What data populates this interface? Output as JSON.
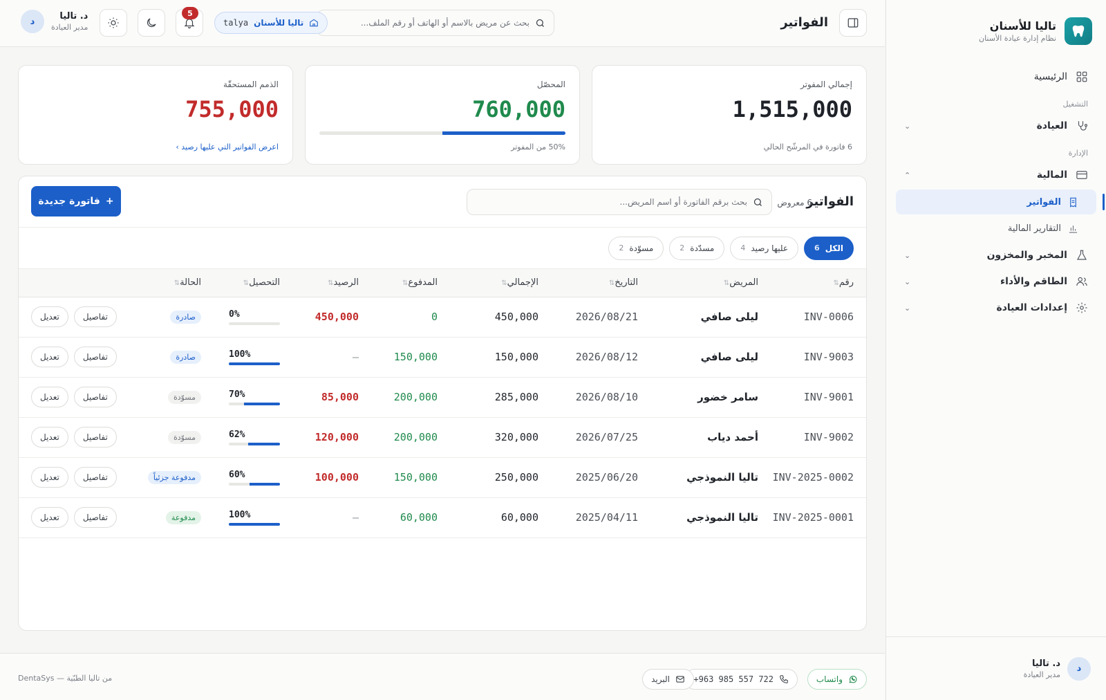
{
  "brand": {
    "name": "تاليا للأسنان",
    "subtitle": "نظام إدارة عيادة الأسنان"
  },
  "nav": {
    "home": "الرئيسية",
    "section_ops": "التشغيل",
    "clinic": "العيادة",
    "section_admin": "الإدارة",
    "finance": "المالية",
    "invoices": "الفواتير",
    "reports": "التقارير المالية",
    "lab": "المخبر والمخزون",
    "staff": "الطاقم والأداء",
    "settings": "إعدادات العيادة"
  },
  "user": {
    "name": "د. تاليا",
    "role": "مدير العيادة",
    "initial": "د"
  },
  "header": {
    "title": "الفواتير",
    "search_placeholder": "بحث عن مريض بالاسم أو الهاتف أو رقم الملف...",
    "clinic_name": "تاليا للأسنان",
    "clinic_slug": "talya",
    "notifications": "5"
  },
  "stats": {
    "invoiced_label": "إجمالي المفوتر",
    "invoiced_value": "1,515,000",
    "invoiced_foot": "6 فاتورة في المرشّح الحالي",
    "collected_label": "المحصّل",
    "collected_value": "760,000",
    "collected_foot": "50% من المفوتر",
    "collected_fraction": 0.5,
    "due_label": "الذمم المستحقّة",
    "due_value": "755,000",
    "due_link": "اعرض الفواتير التي عليها رصيد ›"
  },
  "panel": {
    "title": "الفواتير",
    "count": "6 معروض",
    "search_placeholder": "بحث برقم الفاتورة أو اسم المريض...",
    "new_button": "فاتورة جديدة",
    "new_button_plus": "+"
  },
  "filters": [
    {
      "label": "الكل",
      "count": "6"
    },
    {
      "label": "عليها رصيد",
      "count": "4"
    },
    {
      "label": "مسدّدة",
      "count": "2"
    },
    {
      "label": "مسوّدة",
      "count": "2"
    }
  ],
  "columns": [
    "رقم",
    "المريض",
    "التاريخ",
    "الإجمالي",
    "المدفوع",
    "الرصيد",
    "التحصيل",
    "الحالة"
  ],
  "actions": {
    "details": "تفاصيل",
    "edit": "تعديل"
  },
  "rows": [
    {
      "inv": "INV-0006",
      "patient": "ليلى صافي",
      "date": "2026/08/21",
      "total": "450,000",
      "paid": "0",
      "balance": "450,000",
      "pct": "0%",
      "pct_value": 0,
      "status": "صادرة",
      "status_kind": "issued"
    },
    {
      "inv": "INV-9003",
      "patient": "ليلى صافي",
      "date": "2026/08/12",
      "total": "150,000",
      "paid": "150,000",
      "balance": "—",
      "pct": "100%",
      "pct_value": 100,
      "status": "صادرة",
      "status_kind": "issued"
    },
    {
      "inv": "INV-9001",
      "patient": "سامر خضور",
      "date": "2026/08/10",
      "total": "285,000",
      "paid": "200,000",
      "balance": "85,000",
      "pct": "70%",
      "pct_value": 70,
      "status": "مسوّدة",
      "status_kind": "draft"
    },
    {
      "inv": "INV-9002",
      "patient": "أحمد دياب",
      "date": "2026/07/25",
      "total": "320,000",
      "paid": "200,000",
      "balance": "120,000",
      "pct": "62%",
      "pct_value": 62,
      "status": "مسوّدة",
      "status_kind": "draft"
    },
    {
      "inv": "INV-2025-0002",
      "patient": "تاليا النموذجي",
      "date": "2025/06/20",
      "total": "250,000",
      "paid": "150,000",
      "balance": "100,000",
      "pct": "60%",
      "pct_value": 60,
      "status": "مدفوعة جزئياً",
      "status_kind": "partial"
    },
    {
      "inv": "INV-2025-0001",
      "patient": "تاليا النموذجي",
      "date": "2025/04/11",
      "total": "60,000",
      "paid": "60,000",
      "balance": "—",
      "pct": "100%",
      "pct_value": 100,
      "status": "مدفوعة",
      "status_kind": "paid"
    }
  ],
  "footer": {
    "whatsapp": "واتساب",
    "phone": "+963 985 557 722",
    "email": "البريد",
    "credit": "DentaSys — من تاليا الطبّية"
  },
  "colors": {
    "accent": "#1c5fc9",
    "positive": "#1f8a4c",
    "negative": "#c22b2b",
    "brand": "#1aa1a6"
  }
}
